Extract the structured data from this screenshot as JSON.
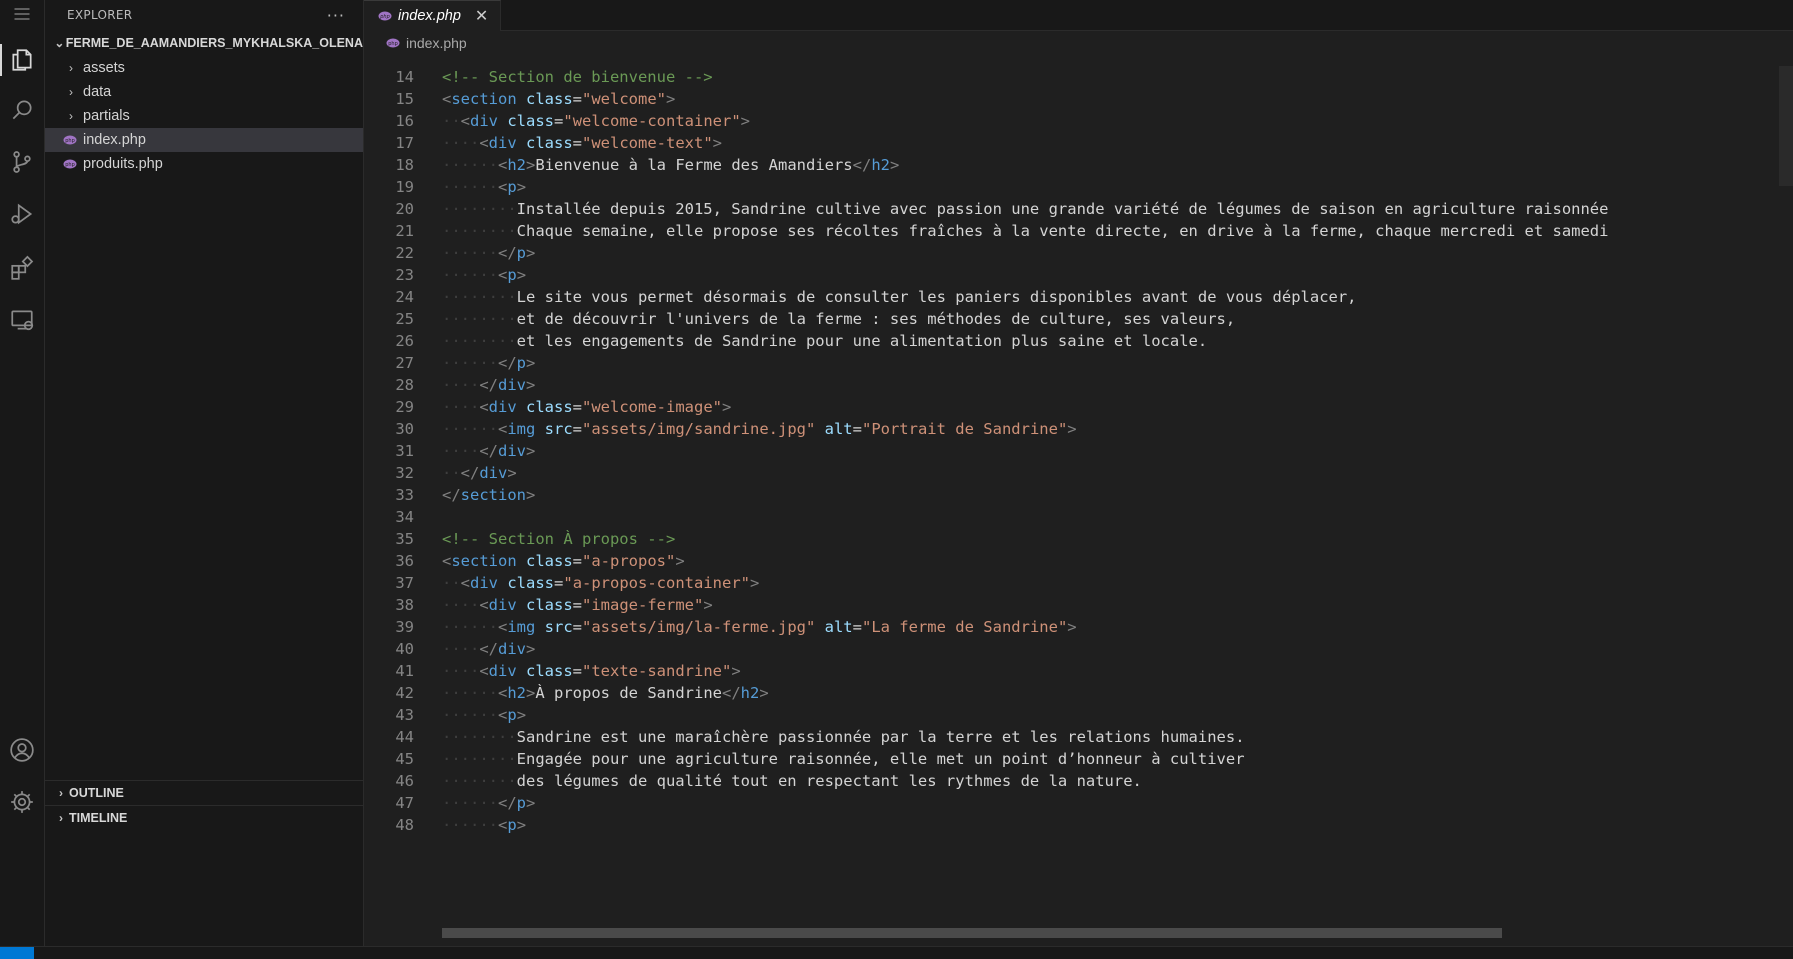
{
  "activity_bar": {
    "items": [
      {
        "icon": "files-icon",
        "active": true
      },
      {
        "icon": "search-icon",
        "active": false
      },
      {
        "icon": "source-control-icon",
        "active": false
      },
      {
        "icon": "run-debug-icon",
        "active": false
      },
      {
        "icon": "extensions-icon",
        "active": false
      },
      {
        "icon": "remote-explorer-icon",
        "active": false
      }
    ],
    "bottom_items": [
      {
        "icon": "account-icon"
      },
      {
        "icon": "settings-gear-icon"
      }
    ]
  },
  "sidebar": {
    "title": "EXPLORER",
    "more": "···",
    "root_folder": "FERME_DE_AAMANDIERS_MYKHALSKA_OLENA",
    "tree": [
      {
        "label": "assets",
        "type": "folder"
      },
      {
        "label": "data",
        "type": "folder"
      },
      {
        "label": "partials",
        "type": "folder"
      },
      {
        "label": "index.php",
        "type": "php",
        "selected": true
      },
      {
        "label": "produits.php",
        "type": "php"
      }
    ],
    "outline": "OUTLINE",
    "timeline": "TIMELINE"
  },
  "editor": {
    "tab_label": "index.php",
    "tab_close": "✕",
    "breadcrumb": "index.php",
    "php_icon_color": "#a074c4",
    "lines": [
      {
        "n": "14",
        "indent": 0,
        "tokens": [
          [
            "c",
            "<!-- Section de bienvenue -->"
          ]
        ]
      },
      {
        "n": "15",
        "indent": 0,
        "tokens": [
          [
            "b",
            "<"
          ],
          [
            "t",
            "section"
          ],
          [
            "a",
            " class"
          ],
          [
            "x",
            "="
          ],
          [
            "s",
            "\"welcome\""
          ],
          [
            "b",
            ">"
          ]
        ]
      },
      {
        "n": "16",
        "indent": 1,
        "tokens": [
          [
            "b",
            "<"
          ],
          [
            "t",
            "div"
          ],
          [
            "a",
            " class"
          ],
          [
            "x",
            "="
          ],
          [
            "s",
            "\"welcome-container\""
          ],
          [
            "b",
            ">"
          ]
        ]
      },
      {
        "n": "17",
        "indent": 2,
        "tokens": [
          [
            "b",
            "<"
          ],
          [
            "t",
            "div"
          ],
          [
            "a",
            " class"
          ],
          [
            "x",
            "="
          ],
          [
            "s",
            "\"welcome-text\""
          ],
          [
            "b",
            ">"
          ]
        ]
      },
      {
        "n": "18",
        "indent": 3,
        "tokens": [
          [
            "b",
            "<"
          ],
          [
            "t",
            "h2"
          ],
          [
            "b",
            ">"
          ],
          [
            "x",
            "Bienvenue à la Ferme des Amandiers"
          ],
          [
            "b",
            "</"
          ],
          [
            "t",
            "h2"
          ],
          [
            "b",
            ">"
          ]
        ]
      },
      {
        "n": "19",
        "indent": 3,
        "tokens": [
          [
            "b",
            "<"
          ],
          [
            "t",
            "p"
          ],
          [
            "b",
            ">"
          ]
        ]
      },
      {
        "n": "20",
        "indent": 4,
        "tokens": [
          [
            "x",
            "Installée depuis 2015, Sandrine cultive avec passion une grande variété de légumes de saison en agriculture raisonnée"
          ]
        ]
      },
      {
        "n": "21",
        "indent": 4,
        "tokens": [
          [
            "x",
            "Chaque semaine, elle propose ses récoltes fraîches à la vente directe, en drive à la ferme, chaque mercredi et samedi"
          ]
        ]
      },
      {
        "n": "22",
        "indent": 3,
        "tokens": [
          [
            "b",
            "</"
          ],
          [
            "t",
            "p"
          ],
          [
            "b",
            ">"
          ]
        ]
      },
      {
        "n": "23",
        "indent": 3,
        "tokens": [
          [
            "b",
            "<"
          ],
          [
            "t",
            "p"
          ],
          [
            "b",
            ">"
          ]
        ]
      },
      {
        "n": "24",
        "indent": 4,
        "tokens": [
          [
            "x",
            "Le site vous permet désormais de consulter les paniers disponibles avant de vous déplacer,"
          ]
        ]
      },
      {
        "n": "25",
        "indent": 4,
        "tokens": [
          [
            "x",
            "et de découvrir l'univers de la ferme : ses méthodes de culture, ses valeurs,"
          ]
        ]
      },
      {
        "n": "26",
        "indent": 4,
        "tokens": [
          [
            "x",
            "et les engagements de Sandrine pour une alimentation plus saine et locale."
          ]
        ]
      },
      {
        "n": "27",
        "indent": 3,
        "tokens": [
          [
            "b",
            "</"
          ],
          [
            "t",
            "p"
          ],
          [
            "b",
            ">"
          ]
        ]
      },
      {
        "n": "28",
        "indent": 2,
        "tokens": [
          [
            "b",
            "</"
          ],
          [
            "t",
            "div"
          ],
          [
            "b",
            ">"
          ]
        ]
      },
      {
        "n": "29",
        "indent": 2,
        "tokens": [
          [
            "b",
            "<"
          ],
          [
            "t",
            "div"
          ],
          [
            "a",
            " class"
          ],
          [
            "x",
            "="
          ],
          [
            "s",
            "\"welcome-image\""
          ],
          [
            "b",
            ">"
          ]
        ]
      },
      {
        "n": "30",
        "indent": 3,
        "tokens": [
          [
            "b",
            "<"
          ],
          [
            "t",
            "img"
          ],
          [
            "a",
            " src"
          ],
          [
            "x",
            "="
          ],
          [
            "s",
            "\"assets/img/sandrine.jpg\""
          ],
          [
            "a",
            " alt"
          ],
          [
            "x",
            "="
          ],
          [
            "s",
            "\"Portrait de Sandrine\""
          ],
          [
            "b",
            ">"
          ]
        ]
      },
      {
        "n": "31",
        "indent": 2,
        "tokens": [
          [
            "b",
            "</"
          ],
          [
            "t",
            "div"
          ],
          [
            "b",
            ">"
          ]
        ]
      },
      {
        "n": "32",
        "indent": 1,
        "tokens": [
          [
            "b",
            "</"
          ],
          [
            "t",
            "div"
          ],
          [
            "b",
            ">"
          ]
        ]
      },
      {
        "n": "33",
        "indent": 0,
        "tokens": [
          [
            "b",
            "</"
          ],
          [
            "t",
            "section"
          ],
          [
            "b",
            ">"
          ]
        ]
      },
      {
        "n": "34",
        "indent": 0,
        "tokens": []
      },
      {
        "n": "35",
        "indent": 0,
        "tokens": [
          [
            "c",
            "<!-- Section À propos -->"
          ]
        ]
      },
      {
        "n": "36",
        "indent": 0,
        "tokens": [
          [
            "b",
            "<"
          ],
          [
            "t",
            "section"
          ],
          [
            "a",
            " class"
          ],
          [
            "x",
            "="
          ],
          [
            "s",
            "\"a-propos\""
          ],
          [
            "b",
            ">"
          ]
        ]
      },
      {
        "n": "37",
        "indent": 1,
        "tokens": [
          [
            "b",
            "<"
          ],
          [
            "t",
            "div"
          ],
          [
            "a",
            " class"
          ],
          [
            "x",
            "="
          ],
          [
            "s",
            "\"a-propos-container\""
          ],
          [
            "b",
            ">"
          ]
        ]
      },
      {
        "n": "38",
        "indent": 2,
        "tokens": [
          [
            "b",
            "<"
          ],
          [
            "t",
            "div"
          ],
          [
            "a",
            " class"
          ],
          [
            "x",
            "="
          ],
          [
            "s",
            "\"image-ferme\""
          ],
          [
            "b",
            ">"
          ]
        ]
      },
      {
        "n": "39",
        "indent": 3,
        "tokens": [
          [
            "b",
            "<"
          ],
          [
            "t",
            "img"
          ],
          [
            "a",
            " src"
          ],
          [
            "x",
            "="
          ],
          [
            "s",
            "\"assets/img/la-ferme.jpg\""
          ],
          [
            "a",
            " alt"
          ],
          [
            "x",
            "="
          ],
          [
            "s",
            "\"La ferme de Sandrine\""
          ],
          [
            "b",
            ">"
          ]
        ]
      },
      {
        "n": "40",
        "indent": 2,
        "tokens": [
          [
            "b",
            "</"
          ],
          [
            "t",
            "div"
          ],
          [
            "b",
            ">"
          ]
        ]
      },
      {
        "n": "41",
        "indent": 2,
        "tokens": [
          [
            "b",
            "<"
          ],
          [
            "t",
            "div"
          ],
          [
            "a",
            " class"
          ],
          [
            "x",
            "="
          ],
          [
            "s",
            "\"texte-sandrine\""
          ],
          [
            "b",
            ">"
          ]
        ]
      },
      {
        "n": "42",
        "indent": 3,
        "tokens": [
          [
            "b",
            "<"
          ],
          [
            "t",
            "h2"
          ],
          [
            "b",
            ">"
          ],
          [
            "x",
            "À propos de Sandrine"
          ],
          [
            "b",
            "</"
          ],
          [
            "t",
            "h2"
          ],
          [
            "b",
            ">"
          ]
        ]
      },
      {
        "n": "43",
        "indent": 3,
        "tokens": [
          [
            "b",
            "<"
          ],
          [
            "t",
            "p"
          ],
          [
            "b",
            ">"
          ]
        ]
      },
      {
        "n": "44",
        "indent": 4,
        "tokens": [
          [
            "x",
            "Sandrine est une maraîchère passionnée par la terre et les relations humaines."
          ]
        ]
      },
      {
        "n": "45",
        "indent": 4,
        "tokens": [
          [
            "x",
            "Engagée pour une agriculture raisonnée, elle met un point d’honneur à cultiver"
          ]
        ]
      },
      {
        "n": "46",
        "indent": 4,
        "tokens": [
          [
            "x",
            "des légumes de qualité tout en respectant les rythmes de la nature."
          ]
        ]
      },
      {
        "n": "47",
        "indent": 3,
        "tokens": [
          [
            "b",
            "</"
          ],
          [
            "t",
            "p"
          ],
          [
            "b",
            ">"
          ]
        ]
      },
      {
        "n": "48",
        "indent": 3,
        "tokens": [
          [
            "b",
            "<"
          ],
          [
            "t",
            "p"
          ],
          [
            "b",
            ">"
          ]
        ]
      }
    ]
  }
}
